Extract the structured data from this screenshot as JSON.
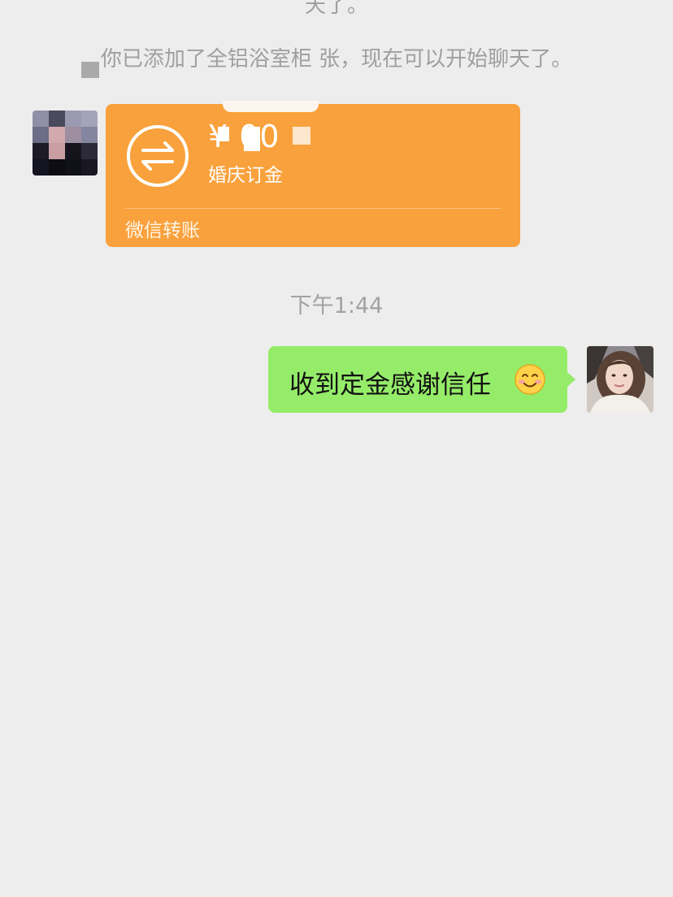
{
  "chat": {
    "top_cut_text": "天了。",
    "added_notice": "你已添加了全铝浴室柜 张，现在可以开始聊天了。",
    "timestamp": "下午1:44"
  },
  "transfer": {
    "amount": "¥     00",
    "memo": "婚庆订金",
    "footer": "微信转账",
    "icon": "transfer-arrows-icon",
    "card_color": "#f9a13c"
  },
  "my_message": {
    "text": "收到定金感谢信任",
    "emoji": "smiling-face-icon",
    "bubble_color": "#95ec69"
  },
  "colors": {
    "background": "#ededed",
    "system_text": "#9f9f9f"
  }
}
